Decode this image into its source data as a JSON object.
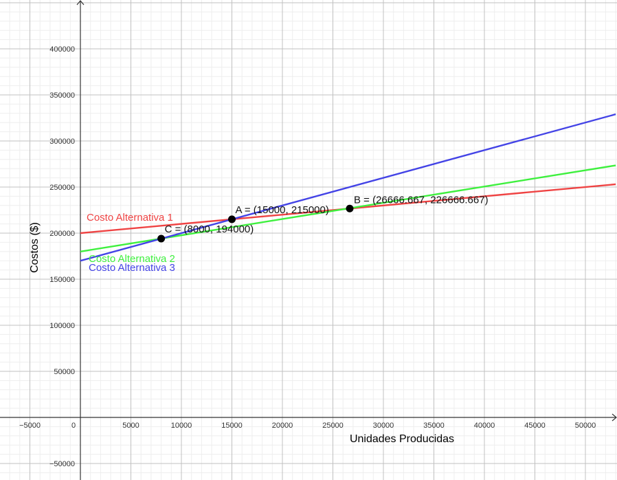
{
  "chart_data": {
    "type": "line",
    "title": "",
    "xlabel": "Unidades Producidas",
    "ylabel": "Costos ($)",
    "xlim": [
      -8000,
      53000
    ],
    "ylim": [
      -68000,
      450000
    ],
    "grid": true,
    "x_ticks": [
      -5000,
      0,
      5000,
      10000,
      15000,
      20000,
      25000,
      30000,
      35000,
      40000,
      45000,
      50000
    ],
    "x_tick_labels": [
      "−5000",
      "0",
      "5000",
      "10000",
      "15000",
      "20000",
      "25000",
      "30000",
      "35000",
      "40000",
      "45000",
      "50000"
    ],
    "y_ticks": [
      -50000,
      50000,
      100000,
      150000,
      200000,
      250000,
      300000,
      350000,
      400000
    ],
    "y_tick_labels": [
      "−50000",
      "50000",
      "100000",
      "150000",
      "200000",
      "250000",
      "300000",
      "350000",
      "400000"
    ],
    "series": [
      {
        "name": "Costo Alternativa 1",
        "color": "#ef4343",
        "x": [
          0,
          53000
        ],
        "values": [
          200000,
          253000
        ]
      },
      {
        "name": "Costo Alternativa 2",
        "color": "#3ef03e",
        "x": [
          0,
          53000
        ],
        "values": [
          180000,
          273500
        ]
      },
      {
        "name": "Costo Alternativa 3",
        "color": "#4343e6",
        "x": [
          0,
          53000
        ],
        "values": [
          170000,
          329000
        ]
      }
    ],
    "points": [
      {
        "label": "A = (15000, 215000)",
        "x": 15000,
        "y": 215000
      },
      {
        "label": "B = (26666.667, 226666.667)",
        "x": 26666.667,
        "y": 226666.667
      },
      {
        "label": "C = (8000, 194000)",
        "x": 8000,
        "y": 194000
      }
    ]
  }
}
